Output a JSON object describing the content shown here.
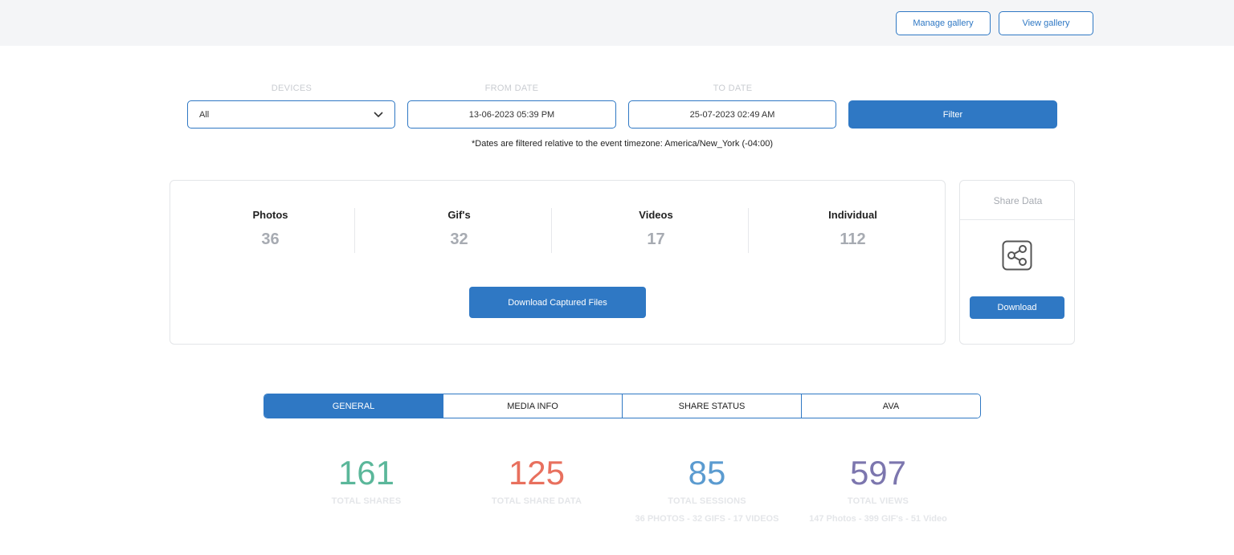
{
  "header": {
    "manage_gallery": "Manage gallery",
    "view_gallery": "View gallery"
  },
  "filters": {
    "devices_label": "DEVICES",
    "devices_value": "All",
    "from_label": "FROM DATE",
    "from_value": "13-06-2023 05:39 PM",
    "to_label": "TO DATE",
    "to_value": "25-07-2023 02:49 AM",
    "filter_button": "Filter",
    "note": "*Dates are filtered relative to the event timezone: America/New_York (-04:00)"
  },
  "stats": {
    "items": [
      {
        "label": "Photos",
        "value": "36"
      },
      {
        "label": "Gif's",
        "value": "32"
      },
      {
        "label": "Videos",
        "value": "17"
      },
      {
        "label": "Individual",
        "value": "112"
      }
    ],
    "download_button": "Download Captured Files"
  },
  "share": {
    "title": "Share Data",
    "icon": "share-icon",
    "download_button": "Download"
  },
  "tabs": [
    {
      "label": "GENERAL",
      "active": true
    },
    {
      "label": "MEDIA INFO",
      "active": false
    },
    {
      "label": "SHARE STATUS",
      "active": false
    },
    {
      "label": "AVA",
      "active": false
    }
  ],
  "metrics": [
    {
      "value": "161",
      "label": "TOTAL SHARES",
      "sub": "",
      "color": "#5bb79a"
    },
    {
      "value": "125",
      "label": "TOTAL SHARE DATA",
      "sub": "",
      "color": "#e8705e"
    },
    {
      "value": "85",
      "label": "TOTAL SESSIONS",
      "sub": "36 PHOTOS - 32 GIFS - 17 VIDEOS",
      "color": "#5b9bd0"
    },
    {
      "value": "597",
      "label": "TOTAL VIEWS",
      "sub": "147 Photos - 399 GIF's - 51 Video",
      "color": "#7c76ae"
    }
  ],
  "colors": {
    "accent": "#2f78c4"
  }
}
